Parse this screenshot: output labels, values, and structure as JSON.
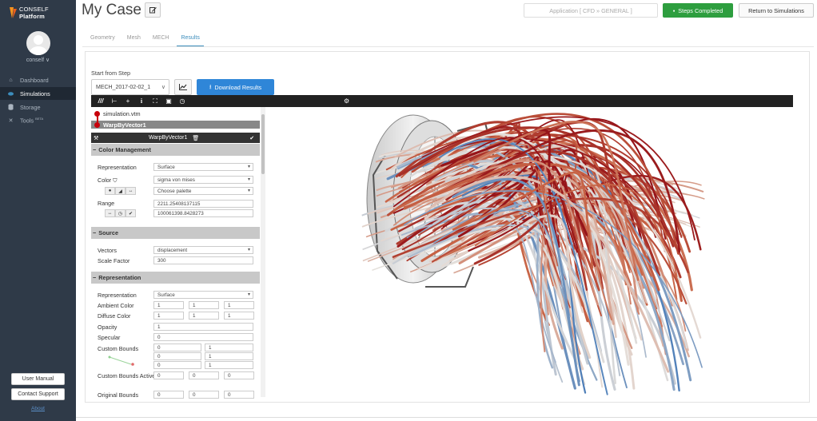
{
  "brand": {
    "name": "CONSELF",
    "product": "Platform"
  },
  "sidebar": {
    "username": "conself ∨",
    "items": [
      {
        "label": "Dashboard",
        "icon": "home-icon"
      },
      {
        "label": "Simulations",
        "icon": "cloud-icon"
      },
      {
        "label": "Storage",
        "icon": "database-icon"
      },
      {
        "label": "Tools",
        "badge": "BETA",
        "icon": "tools-icon"
      }
    ],
    "user_manual": "User Manual",
    "contact_support": "Contact Support",
    "about": "About"
  },
  "header": {
    "title": "My Case",
    "application": "Application [ CFD » GENERAL ]",
    "steps_completed": "Steps Completed",
    "return": "Return to Simulations"
  },
  "tabs": [
    {
      "label": "Geometry",
      "active": false
    },
    {
      "label": "Mesh",
      "active": false
    },
    {
      "label": "MECH",
      "active": false
    },
    {
      "label": "Results",
      "active": true
    }
  ],
  "results": {
    "start_from_step_label": "Start from Step",
    "step_value": "MECH_2017-02-02_1",
    "download_label": "Download Results"
  },
  "pipeline": {
    "items": [
      "simulation.vtm",
      "WarpByVector1"
    ]
  },
  "properties": {
    "title": "WarpByVector1",
    "color_management": {
      "header": "Color Management",
      "representation_label": "Representation",
      "representation_value": "Surface",
      "color_label": "Color",
      "color_value": "sigma von mises",
      "palette_value": "Choose palette",
      "range_label": "Range",
      "range_min": "2211.25408137115",
      "range_max": "100061398.8428273"
    },
    "source": {
      "header": "Source",
      "vectors_label": "Vectors",
      "vectors_value": "displacement",
      "scale_label": "Scale Factor",
      "scale_value": "300"
    },
    "representation": {
      "header": "Representation",
      "representation_label": "Representation",
      "representation_value": "Surface",
      "ambient_label": "Ambient Color",
      "ambient": [
        "1",
        "1",
        "1"
      ],
      "diffuse_label": "Diffuse Color",
      "diffuse": [
        "1",
        "1",
        "1"
      ],
      "opacity_label": "Opacity",
      "opacity_value": "1",
      "specular_label": "Specular",
      "specular_value": "0",
      "custom_bounds_label": "Custom Bounds",
      "custom_bounds": [
        "0",
        "1",
        "0",
        "1",
        "0",
        "1"
      ],
      "custom_bounds_active_label": "Custom Bounds Active",
      "custom_bounds_active": [
        "0",
        "0",
        "0"
      ],
      "original_bounds_label": "Original Bounds",
      "original_bounds": [
        "0",
        "0",
        "0"
      ]
    }
  },
  "colors": {
    "sidebar": "#2f3a48",
    "accent": "#3c8dbc",
    "success": "#2e9e3f",
    "primary": "#2f86d8",
    "pipeline_red": "#c7000b"
  }
}
